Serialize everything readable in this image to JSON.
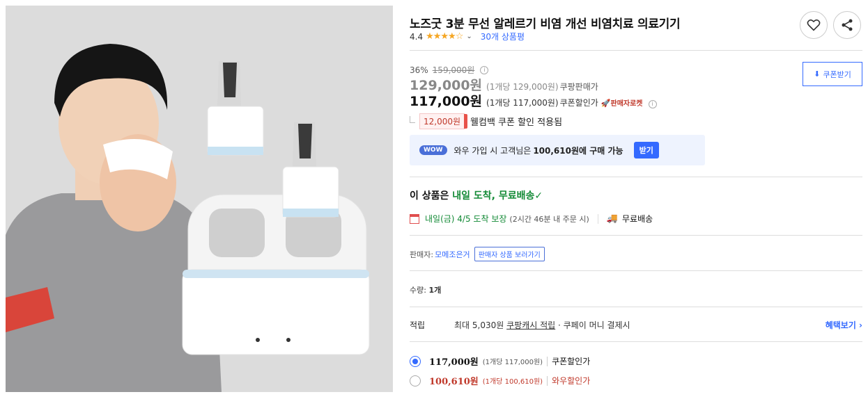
{
  "product": {
    "title": "노즈굿 3분 무선 알레르기 비염 개선 비염치료 의료기기",
    "rating": "4.4",
    "stars": "★★★★☆",
    "reviews": "30개 상품평"
  },
  "pricing": {
    "discount": "36%",
    "original": "159,000원",
    "price": "129,000원",
    "price_unit": "(1개당 129,000원)",
    "price_label": "쿠팡판매가",
    "coupon_price": "117,000원",
    "coupon_unit": "(1개당 117,000원)",
    "coupon_label": "쿠폰할인가",
    "rocket_label": "판매자로켓",
    "coupon_button": "쿠폰받기"
  },
  "welcome": {
    "amount": "12,000원",
    "text": "웰컴백 쿠폰 할인 적용됨"
  },
  "wow": {
    "badge": "WOW",
    "text_pre": "와우 가입 시 고객님은",
    "amount": "100,610원에 구매 가능",
    "button": "받기"
  },
  "delivery": {
    "title_prefix": "이 상품은",
    "title_green": "내일 도착, 무료배송",
    "check": "✓",
    "arrival": "내일(금) 4/5 도착 보장",
    "arrival_note": "(2시간 46분 내 주문 시)",
    "free_shipping": "무료배송"
  },
  "seller": {
    "label": "판매자:",
    "name": "모메조은거",
    "button": "판매자 상품 보러가기"
  },
  "quantity": {
    "label": "수량:",
    "value": "1개"
  },
  "reward": {
    "label": "적립",
    "max": "최대 5,030원",
    "cash": "쿠팡캐시 적립",
    "rest": "· 쿠페이 머니 결제시",
    "benefit": "혜택보기 ›"
  },
  "options": [
    {
      "price": "117,000원",
      "unit": "(1개당 117,000원)",
      "label": "쿠폰할인가",
      "selected": true
    },
    {
      "price": "100,610원",
      "unit": "(1개당 100,610원)",
      "label": "와우할인가",
      "selected": false
    }
  ]
}
